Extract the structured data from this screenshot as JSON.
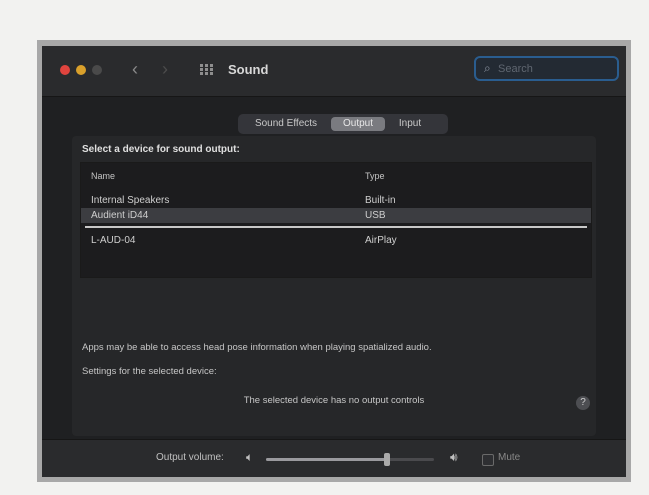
{
  "window": {
    "title": "Sound"
  },
  "search": {
    "placeholder": "Search"
  },
  "tabs": [
    {
      "label": "Sound Effects",
      "selected": false
    },
    {
      "label": "Output",
      "selected": true
    },
    {
      "label": "Input",
      "selected": false
    }
  ],
  "output": {
    "heading": "Select a device for sound output:",
    "columns": {
      "name": "Name",
      "type": "Type"
    },
    "devices": [
      {
        "name": "Internal Speakers",
        "type": "Built-in"
      },
      {
        "name": "Audient iD44",
        "type": "USB",
        "selected": true
      },
      {
        "name": "L-AUD-04",
        "type": "AirPlay"
      }
    ],
    "spatial_note": "Apps may be able to access head pose information when playing spatialized audio.",
    "settings_label": "Settings for the selected device:",
    "no_controls": "The selected device has no output controls"
  },
  "volume": {
    "label": "Output volume:",
    "level": 0.72,
    "mute_label": "Mute",
    "muted": false
  },
  "colors": {
    "accent": "#2a5d8f",
    "background": "#1f2022"
  },
  "icons": [
    "search-icon",
    "chevron-left-icon",
    "chevron-right-icon",
    "grid-icon",
    "speaker-low-icon",
    "speaker-high-icon",
    "help-icon"
  ]
}
